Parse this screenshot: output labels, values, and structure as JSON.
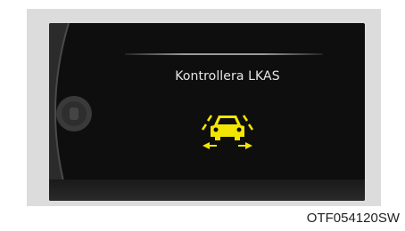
{
  "cluster": {
    "message": "Kontrollera LKAS",
    "warning_icon": "lkas-lane-keeping-icon",
    "icon_color": "#f2e600"
  },
  "figure": {
    "caption": "OTF054120SW"
  }
}
